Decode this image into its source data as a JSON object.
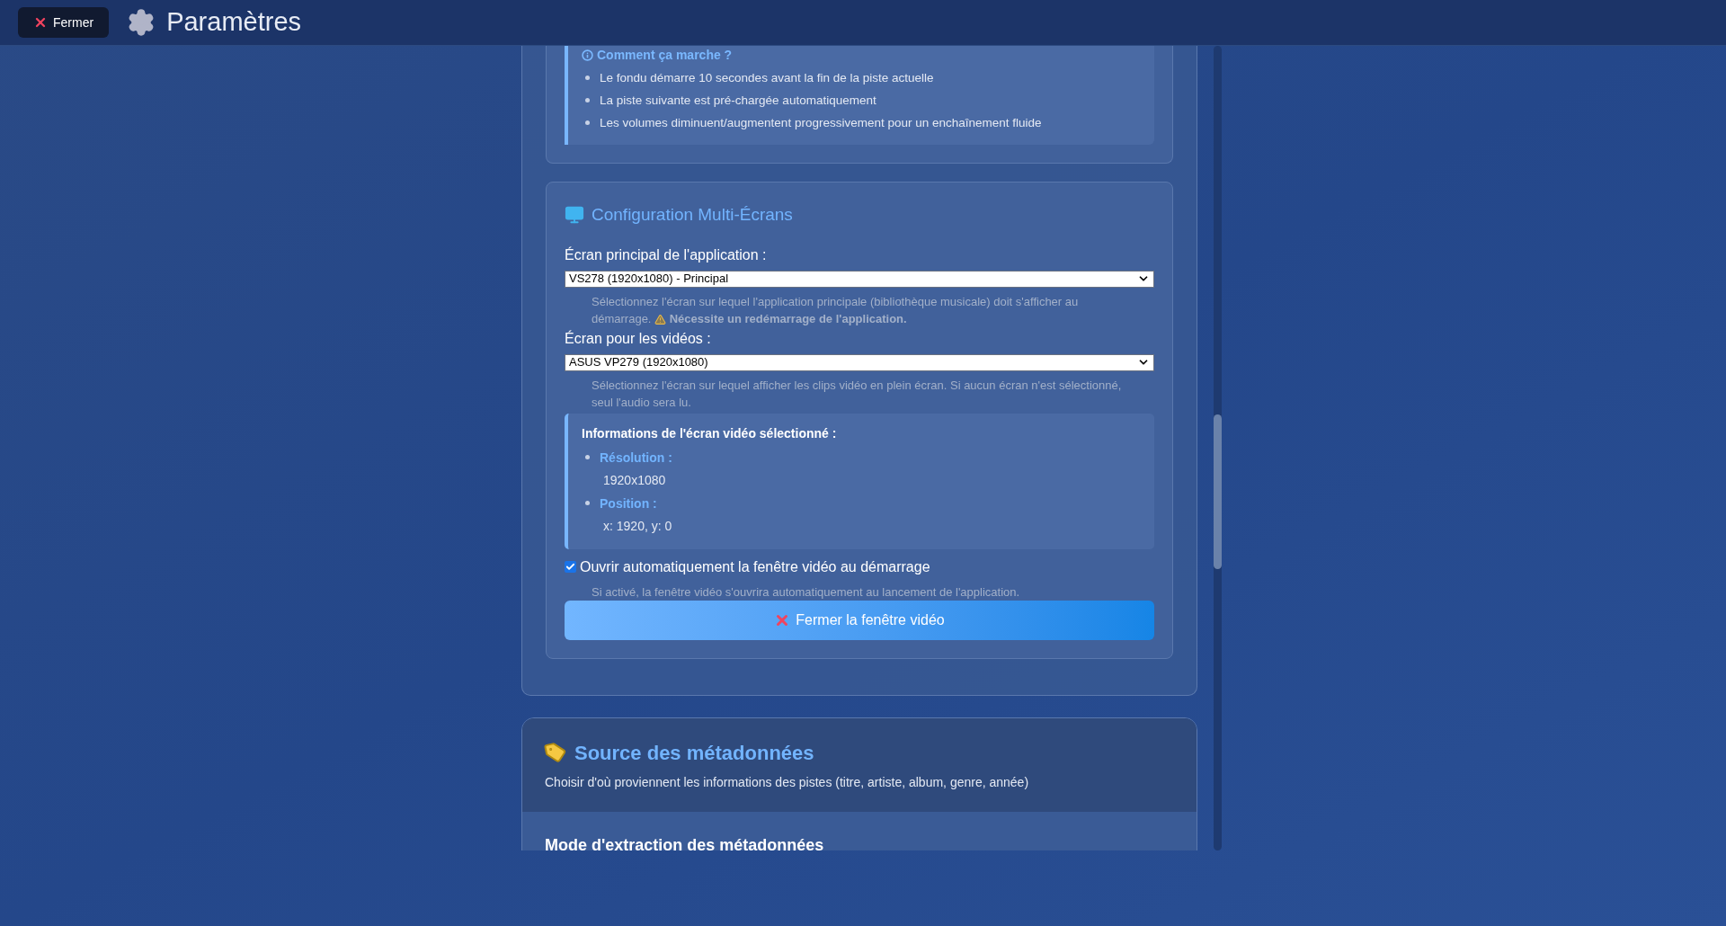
{
  "header": {
    "close_button": "Fermer",
    "title": "Paramètres"
  },
  "crossfade_info": {
    "title": "Comment ça marche ?",
    "items": [
      "Le fondu démarre 10 secondes avant la fin de la piste actuelle",
      "La piste suivante est pré-chargée automatiquement",
      "Les volumes diminuent/augmentent progressivement pour un enchaînement fluide"
    ]
  },
  "multi_screen": {
    "title": "Configuration Multi-Écrans",
    "main_screen": {
      "label": "Écran principal de l'application :",
      "value": "VS278 (1920x1080) - Principal",
      "help": "Sélectionnez l'écran sur lequel l'application principale (bibliothèque musicale) doit s'afficher au démarrage.",
      "warning": "Nécessite un redémarrage de l'application."
    },
    "video_screen": {
      "label": "Écran pour les vidéos :",
      "value": "ASUS VP279 (1920x1080)",
      "help": "Sélectionnez l'écran sur lequel afficher les clips vidéo en plein écran. Si aucun écran n'est sélectionné, seul l'audio sera lu."
    },
    "video_info": {
      "title": "Informations de l'écran vidéo sélectionné :",
      "items": [
        {
          "label": "Résolution :",
          "value": "1920x1080"
        },
        {
          "label": "Position :",
          "value": "x: 1920, y: 0"
        }
      ]
    },
    "auto_open": {
      "label": "Ouvrir automatiquement la fenêtre vidéo au démarrage",
      "checked": true,
      "help": "Si activé, la fenêtre vidéo s'ouvrira automatiquement au lancement de l'application."
    },
    "close_video_button": "Fermer la fenêtre vidéo"
  },
  "metadata_section": {
    "title": "Source des métadonnées",
    "subtitle": "Choisir d'où proviennent les informations des pistes (titre, artiste, album, genre, année)",
    "mode_title": "Mode d'extraction des métadonnées"
  }
}
